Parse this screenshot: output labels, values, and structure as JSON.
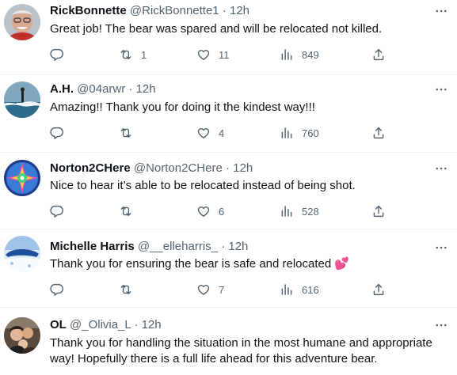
{
  "tweets": [
    {
      "name": "RickBonnette",
      "handle": "@RickBonnette1",
      "sep": "·",
      "time": "12h",
      "text": "Great job! The bear was spared and will be relocated not killed.",
      "replies": "",
      "retweets": "1",
      "likes": "11",
      "views": "849"
    },
    {
      "name": "A.H.",
      "handle": "@04arwr",
      "sep": "·",
      "time": "12h",
      "text": "Amazing!! Thank you for doing it the kindest way!!!",
      "replies": "",
      "retweets": "",
      "likes": "4",
      "views": "760"
    },
    {
      "name": "Norton2CHere",
      "handle": "@Norton2CHere",
      "sep": "·",
      "time": "12h",
      "text": "Nice to hear it’s able to be relocated instead of being shot.",
      "replies": "",
      "retweets": "",
      "likes": "6",
      "views": "528"
    },
    {
      "name": "Michelle Harris",
      "handle": "@__elleharris_",
      "sep": "·",
      "time": "12h",
      "text": "Thank you for ensuring the bear is safe and relocated 💕",
      "replies": "",
      "retweets": "",
      "likes": "7",
      "views": "616"
    },
    {
      "name": "OL",
      "handle": "@_Olivia_L",
      "sep": "·",
      "time": "12h",
      "text": "Thank you for handling the situation in the most humane and appropriate way!  Hopefully there is a full life ahead for this adventure bear.",
      "replies": "",
      "retweets": "",
      "likes": "",
      "views": ""
    }
  ],
  "icons": {
    "reply": "reply-icon",
    "retweet": "retweet-icon",
    "like": "heart-icon",
    "views": "views-icon",
    "share": "share-icon",
    "more": "more-icon"
  },
  "colors": {
    "text": "#0f1419",
    "secondary": "#536471",
    "divider": "#eff3f4"
  }
}
